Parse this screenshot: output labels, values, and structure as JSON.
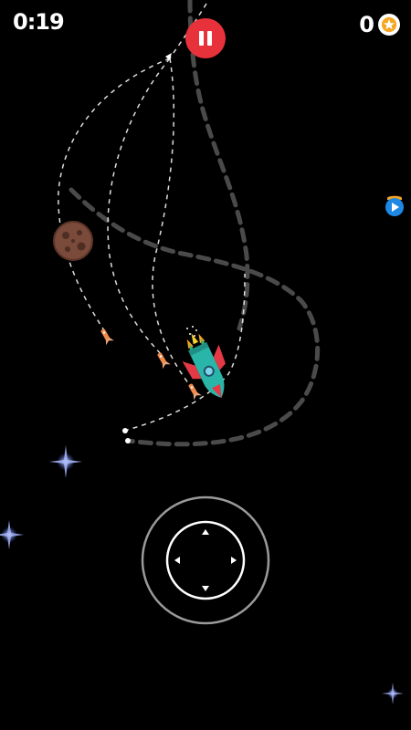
{
  "hud": {
    "timer": "0:19",
    "coin_count": "0"
  },
  "icons": {
    "pause": "pause-icon",
    "coin": "star-coin-icon",
    "video_ad": "video-play-icon",
    "joystick": "virtual-joystick"
  },
  "colors": {
    "pause_button": "#e8323b",
    "coin_star": "#f5a623",
    "video_ad": "#1e88e5",
    "asteroid": "#7a4a3a",
    "rocket_body": "#29b6a8",
    "rocket_fins": "#e53945",
    "missile": "#f08a4b"
  }
}
